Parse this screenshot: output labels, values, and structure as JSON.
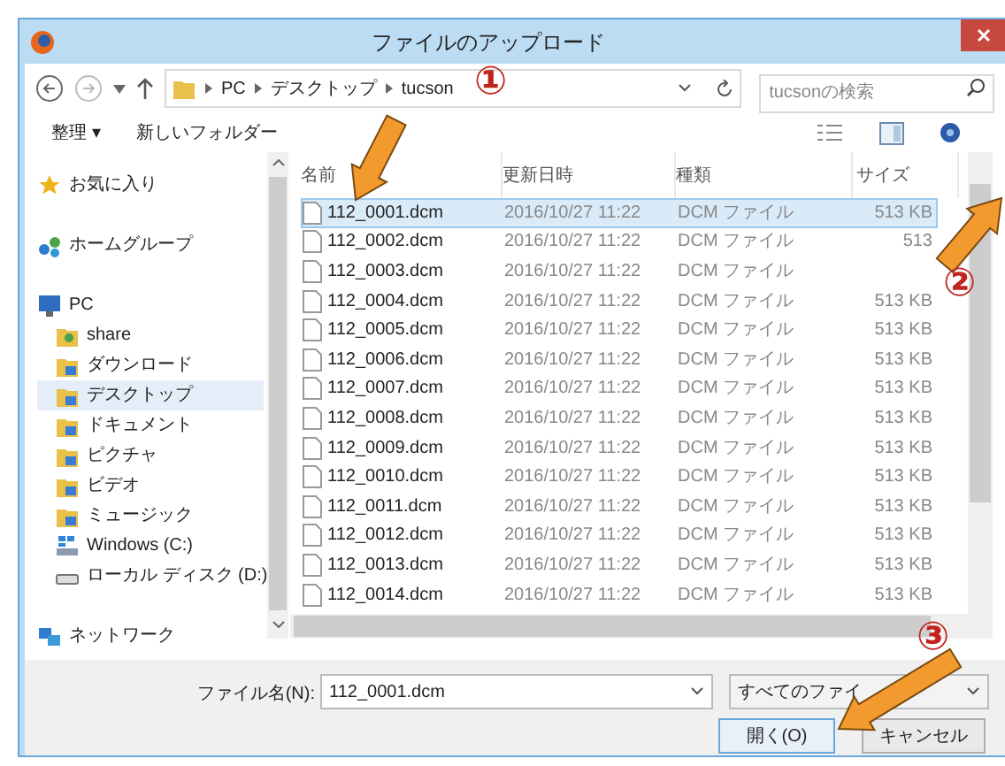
{
  "window": {
    "title": "ファイルのアップロード"
  },
  "address_bar": {
    "path": [
      "PC",
      "デスクトップ",
      "tucson"
    ],
    "search": {
      "placeholder": "tucsonの検索"
    }
  },
  "toolbar": {
    "organize": "整理 ▾",
    "new_folder": "新しいフォルダー"
  },
  "sidebar": {
    "items": [
      {
        "label": "お気に入り",
        "kind": "star",
        "selected": false
      },
      {
        "label": "ホームグループ",
        "kind": "group",
        "selected": false
      },
      {
        "label": "PC",
        "kind": "pc",
        "selected": false,
        "children": [
          {
            "label": "share",
            "kind": "user",
            "selected": false
          },
          {
            "label": "ダウンロード",
            "kind": "folder",
            "selected": false
          },
          {
            "label": "デスクトップ",
            "kind": "folder",
            "selected": true
          },
          {
            "label": "ドキュメント",
            "kind": "folder",
            "selected": false
          },
          {
            "label": "ピクチャ",
            "kind": "folder",
            "selected": false
          },
          {
            "label": "ビデオ",
            "kind": "folder",
            "selected": false
          },
          {
            "label": "ミュージック",
            "kind": "folder",
            "selected": false
          },
          {
            "label": "Windows (C:)",
            "kind": "drive",
            "selected": false
          },
          {
            "label": "ローカル ディスク (D:)",
            "kind": "disk",
            "selected": false
          }
        ]
      },
      {
        "label": "ネットワーク",
        "kind": "network",
        "selected": false
      }
    ]
  },
  "table": {
    "columns": [
      "名前",
      "更新日時",
      "種類",
      "サイズ"
    ],
    "rows": [
      {
        "name": "112_0001.dcm",
        "date": "2016/10/27 11:22",
        "type": "DCM ファイル",
        "size": "513 KB",
        "selected": true
      },
      {
        "name": "112_0002.dcm",
        "date": "2016/10/27 11:22",
        "type": "DCM ファイル",
        "size": "513",
        "selected": false
      },
      {
        "name": "112_0003.dcm",
        "date": "2016/10/27 11:22",
        "type": "DCM ファイル",
        "selected": false
      },
      {
        "name": "112_0004.dcm",
        "date": "2016/10/27 11:22",
        "type": "DCM ファイル",
        "size": "513 KB",
        "selected": false
      },
      {
        "name": "112_0005.dcm",
        "date": "2016/10/27 11:22",
        "type": "DCM ファイル",
        "size": "513 KB",
        "selected": false
      },
      {
        "name": "112_0006.dcm",
        "date": "2016/10/27 11:22",
        "type": "DCM ファイル",
        "size": "513 KB",
        "selected": false
      },
      {
        "name": "112_0007.dcm",
        "date": "2016/10/27 11:22",
        "type": "DCM ファイル",
        "size": "513 KB",
        "selected": false
      },
      {
        "name": "112_0008.dcm",
        "date": "2016/10/27 11:22",
        "type": "DCM ファイル",
        "size": "513 KB",
        "selected": false
      },
      {
        "name": "112_0009.dcm",
        "date": "2016/10/27 11:22",
        "type": "DCM ファイル",
        "size": "513 KB",
        "selected": false
      },
      {
        "name": "112_0010.dcm",
        "date": "2016/10/27 11:22",
        "type": "DCM ファイル",
        "size": "513 KB",
        "selected": false
      },
      {
        "name": "112_0011.dcm",
        "date": "2016/10/27 11:22",
        "type": "DCM ファイル",
        "size": "513 KB",
        "selected": false
      },
      {
        "name": "112_0012.dcm",
        "date": "2016/10/27 11:22",
        "type": "DCM ファイル",
        "size": "513 KB",
        "selected": false
      },
      {
        "name": "112_0013.dcm",
        "date": "2016/10/27 11:22",
        "type": "DCM ファイル",
        "size": "513 KB",
        "selected": false
      },
      {
        "name": "112_0014.dcm",
        "date": "2016/10/27 11:22",
        "type": "DCM ファイル",
        "size": "513 KB",
        "selected": false
      }
    ]
  },
  "footer": {
    "filename_label": "ファイル名(N):",
    "filename": "112_0001.dcm",
    "filetype": "すべてのファイ",
    "open": "開く(O)",
    "cancel": "キャンセル"
  },
  "annotations": [
    "①",
    "②",
    "③"
  ]
}
